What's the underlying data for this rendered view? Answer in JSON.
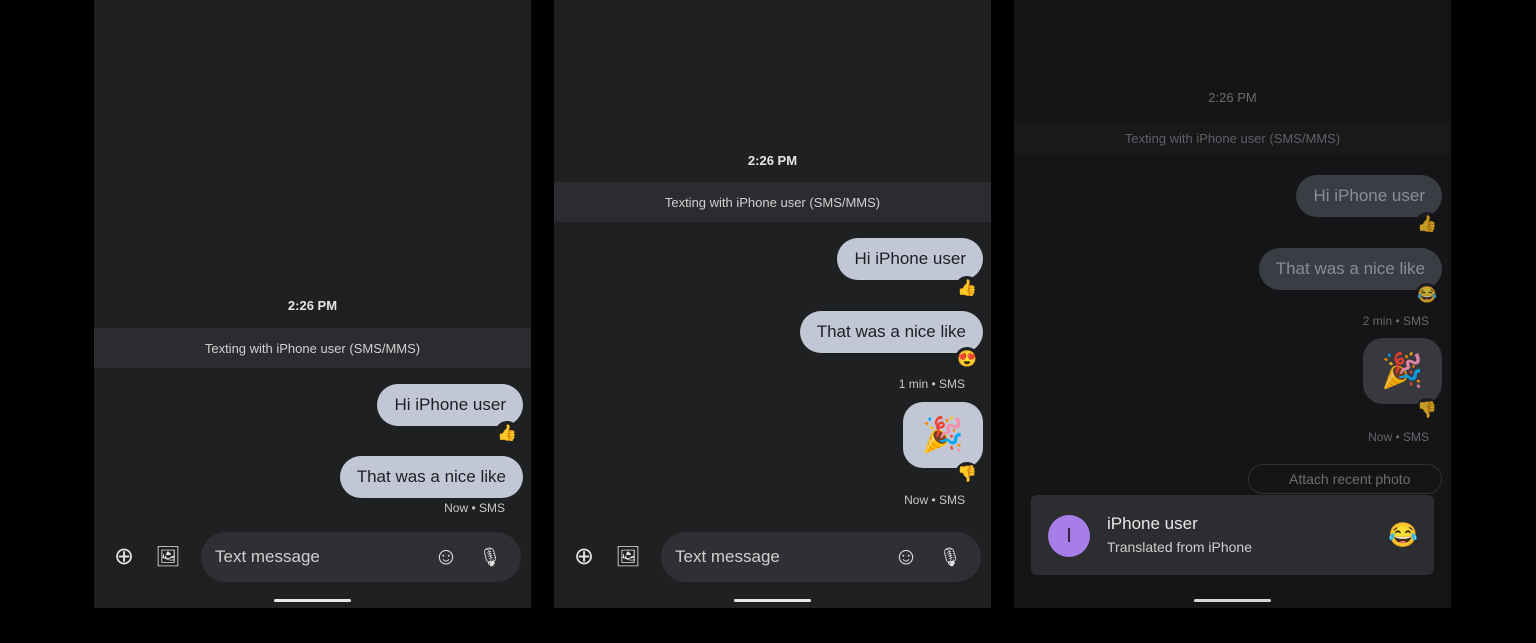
{
  "common": {
    "composer_placeholder": "Text message",
    "banner": "Texting with iPhone user (SMS/MMS)",
    "time": "2:26 PM"
  },
  "panel1": {
    "messages": [
      {
        "text": "Hi iPhone user",
        "reaction": "👍"
      },
      {
        "text": "That was a nice like"
      }
    ],
    "status": "Now • SMS"
  },
  "panel2": {
    "messages": [
      {
        "text": "Hi iPhone user",
        "reaction": "👍"
      },
      {
        "text": "That was a nice like",
        "reaction": "😍"
      }
    ],
    "status1": "1 min • SMS",
    "sticker": "🎉",
    "sticker_reaction": "👎",
    "status2": "Now • SMS"
  },
  "panel3": {
    "messages": [
      {
        "text": "Hi iPhone user",
        "reaction": "👍"
      },
      {
        "text": "That was a nice like",
        "reaction": "😂"
      }
    ],
    "status1": "2 min • SMS",
    "sticker": "🎉",
    "sticker_reaction": "👎",
    "status2": "Now • SMS",
    "attach_chip": "Attach recent photo",
    "notification": {
      "avatar_letter": "I",
      "title": "iPhone user",
      "subtitle": "Translated from iPhone",
      "emoji": "😂",
      "avatar_color": "#a77de8"
    }
  },
  "icons": {
    "add": "⊕",
    "gallery": "🖼",
    "emoji": "☺",
    "mic": "🎙"
  }
}
